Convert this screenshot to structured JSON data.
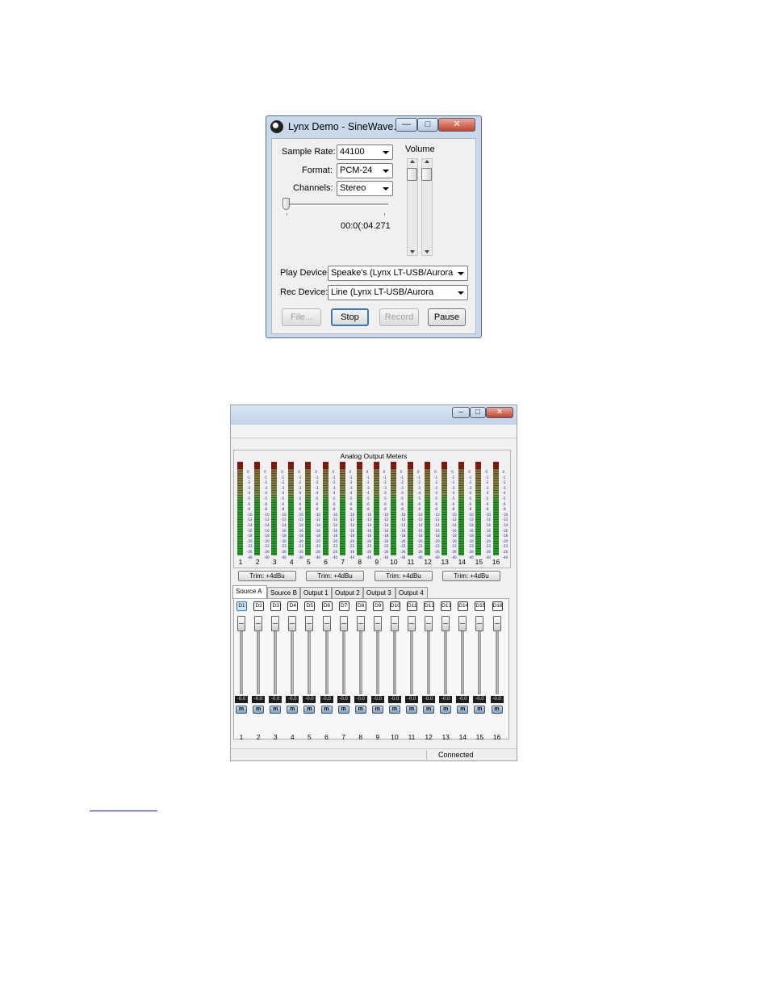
{
  "lynx_demo": {
    "title": "Lynx Demo - SineWave...",
    "window_buttons": {
      "minimize": "—",
      "maximize": "□",
      "close": "✕"
    },
    "sample_rate": {
      "label": "Sample Rate:",
      "value": "44100"
    },
    "format": {
      "label": "Format:",
      "value": "PCM-24"
    },
    "channels": {
      "label": "Channels:",
      "value": "Stereo"
    },
    "position_time": "00:0(:04.271",
    "volume_label": "Volume",
    "play_device": {
      "label": "Play Device:",
      "value": "Speake's (Lynx LT-USB/Aurora"
    },
    "rec_device": {
      "label": "Rec Device:",
      "value": "Line (Lynx LT-USB/Aurora"
    },
    "buttons": {
      "file": "File...",
      "stop": "Stop",
      "record": "Record",
      "pause": "Pause"
    }
  },
  "mixer": {
    "window_buttons": {
      "minimize": "–",
      "maximize": "□",
      "close": "✕"
    },
    "meters_title": "Analog Output Meters",
    "meter_scale": [
      "0",
      "-1",
      "-2",
      "-3",
      "-4",
      "-5",
      "-6",
      "-8",
      "-10",
      "-12",
      "-14",
      "-16",
      "-18",
      "-20",
      "-23",
      "-26",
      "-40"
    ],
    "meter_channels": [
      "1",
      "2",
      "3",
      "4",
      "5",
      "6",
      "7",
      "8",
      "9",
      "10",
      "11",
      "12",
      "13",
      "14",
      "15",
      "16"
    ],
    "trim_buttons": [
      "Trim: +4dBu",
      "Trim: +4dBu",
      "Trim: +4dBu",
      "Trim: +4dBu"
    ],
    "tabs": [
      "Source A",
      "Source B",
      "Output 1",
      "Output 2",
      "Output 3",
      "Output 4"
    ],
    "active_tab": "Source A",
    "source_buttons": [
      "D1",
      "D2",
      "D3",
      "D4",
      "D5",
      "D6",
      "D7",
      "D8",
      "D9",
      "D10",
      "D11",
      "D12",
      "D13",
      "D14",
      "D15",
      "D16"
    ],
    "fader_values": [
      "-0.0",
      "-0.0",
      "-0.0",
      "-0.0",
      "-0.0",
      "-0.0",
      "-0.0",
      "-0.0",
      "-0.0",
      "-0.0",
      "-0.0",
      "-0.0",
      "-0.0",
      "-0.0",
      "-0.0",
      "-0.0"
    ],
    "mute_label": "m",
    "strip_numbers": [
      "1",
      "2",
      "3",
      "4",
      "5",
      "6",
      "7",
      "8",
      "9",
      "10",
      "11",
      "12",
      "13",
      "14",
      "15",
      "16"
    ],
    "status": "Connected"
  }
}
